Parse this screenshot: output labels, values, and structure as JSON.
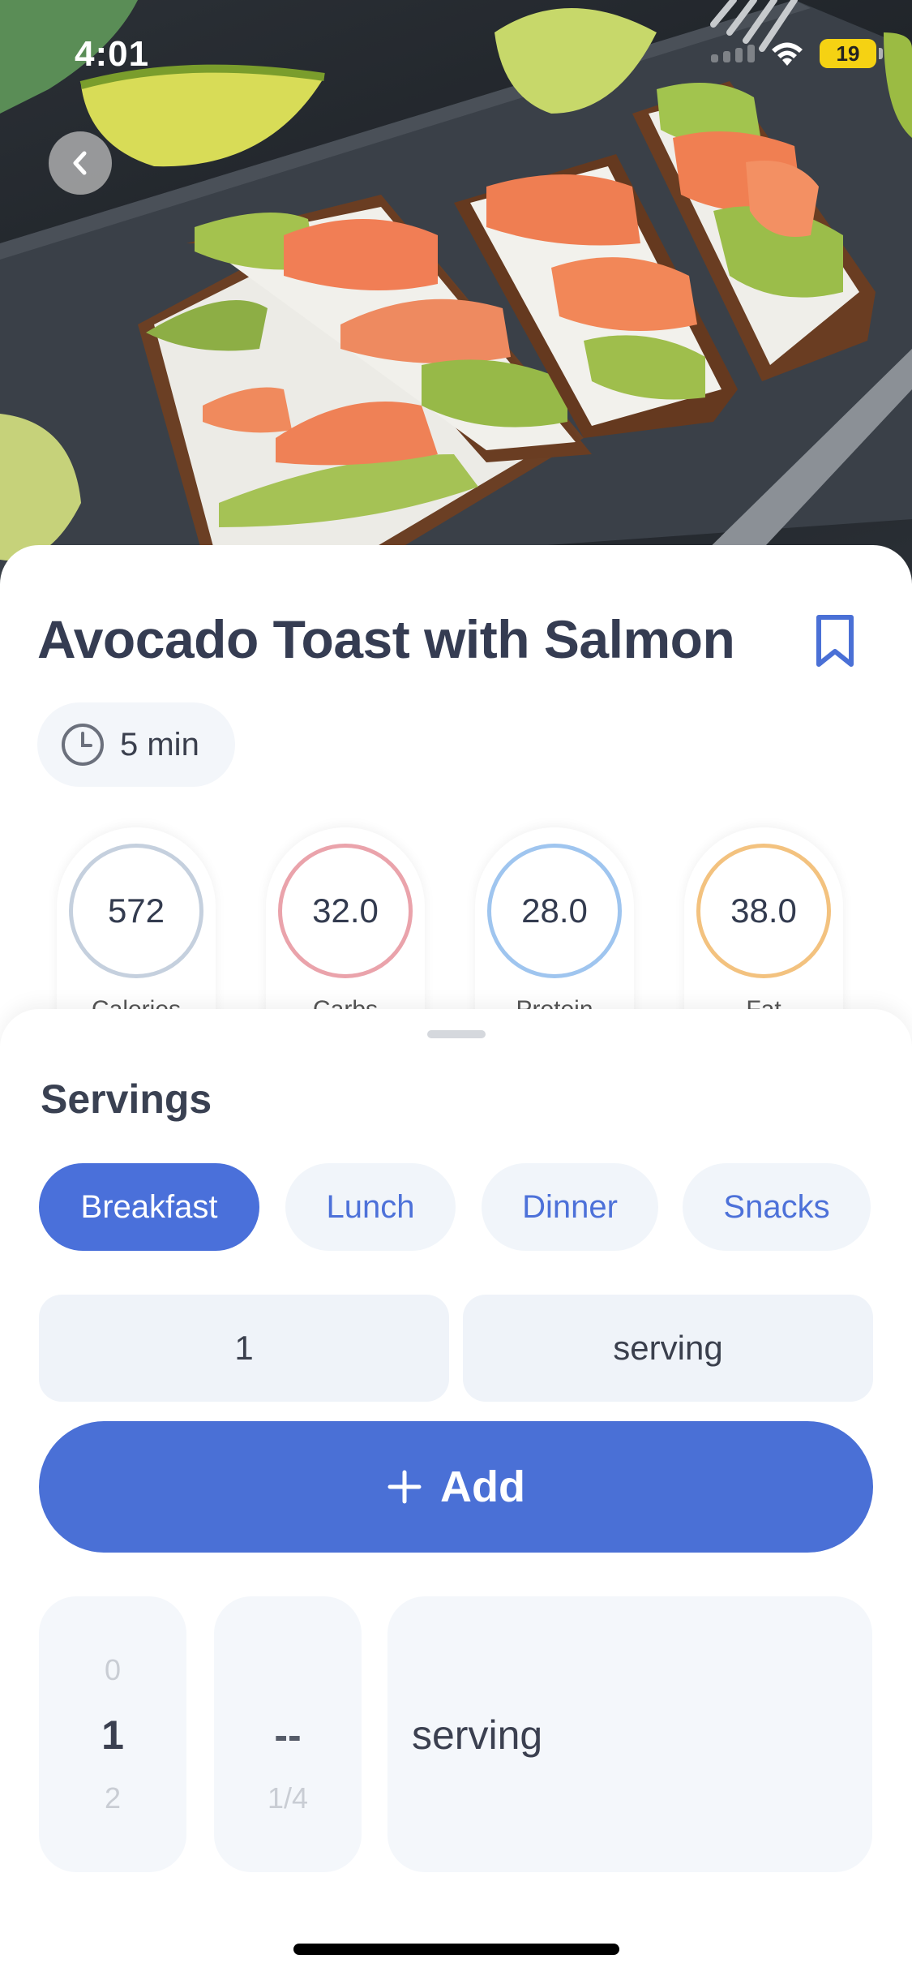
{
  "status_bar": {
    "time": "4:01",
    "battery": "19"
  },
  "recipe": {
    "title": "Avocado Toast with Salmon",
    "time": "5 min"
  },
  "nutrition": [
    {
      "value": "572",
      "label": "Calories",
      "ring_color": "#c5d0de"
    },
    {
      "value": "32.0",
      "label": "Carbs",
      "ring_color": "#eaa3ab"
    },
    {
      "value": "28.0",
      "label": "Protein",
      "ring_color": "#9fc5ef"
    },
    {
      "value": "38.0",
      "label": "Fat",
      "ring_color": "#f3c27f"
    }
  ],
  "servings": {
    "heading": "Servings",
    "meal_tabs": [
      {
        "label": "Breakfast",
        "active": true
      },
      {
        "label": "Lunch",
        "active": false
      },
      {
        "label": "Dinner",
        "active": false
      },
      {
        "label": "Snacks",
        "active": false
      }
    ],
    "quantity": "1",
    "unit": "serving",
    "add_label": "Add"
  },
  "picker": {
    "numbers": {
      "above": "0",
      "selected": "1",
      "below": "2"
    },
    "fractions": {
      "selected": "--",
      "below": "1/4"
    },
    "unit": "serving"
  },
  "colors": {
    "accent": "#4a70d6",
    "chip_bg": "#f1f5fa",
    "title": "#353c52"
  },
  "icons": {
    "back": "chevron-left-icon",
    "bookmark": "bookmark-icon",
    "clock": "clock-icon",
    "add": "plus-icon"
  }
}
